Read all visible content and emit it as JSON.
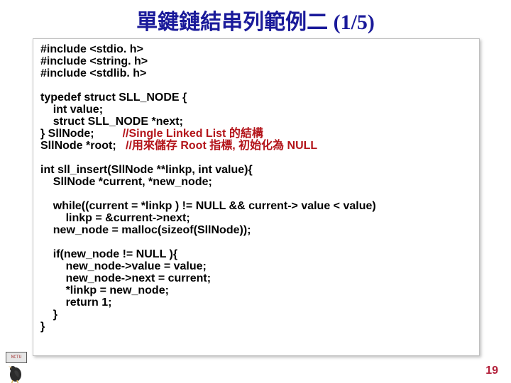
{
  "title": "單鍵鏈結串列範例二 (1/5)",
  "page_number": "19",
  "code": {
    "l1": "#include <stdio. h>",
    "l2": "#include <string. h>",
    "l3": "#include <stdlib. h>",
    "l4": "",
    "l5": "typedef struct SLL_NODE {",
    "l6": "    int value;",
    "l7": "    struct SLL_NODE *next;",
    "l8a": "} SllNode;         ",
    "l8b": "//Single Linked List 的結構",
    "l9a": "SllNode *root;   ",
    "l9b": "//用來儲存 Root 指標, 初始化為 NULL",
    "l10": "",
    "l11": "int sll_insert(SllNode **linkp, int value){",
    "l12": "    SllNode *current, *new_node;",
    "l13": "",
    "l14": "    while((current = *linkp ) != NULL && current-> value < value)",
    "l15": "        linkp = &current->next;",
    "l16": "    new_node = malloc(sizeof(SllNode));",
    "l17": "",
    "l18": "    if(new_node != NULL ){",
    "l19": "        new_node->value = value;",
    "l20": "        new_node->next = current;",
    "l21": "        *linkp = new_node;",
    "l22": "        return 1;",
    "l23": "    }",
    "l24": "}"
  },
  "logo_text": "NCTU"
}
